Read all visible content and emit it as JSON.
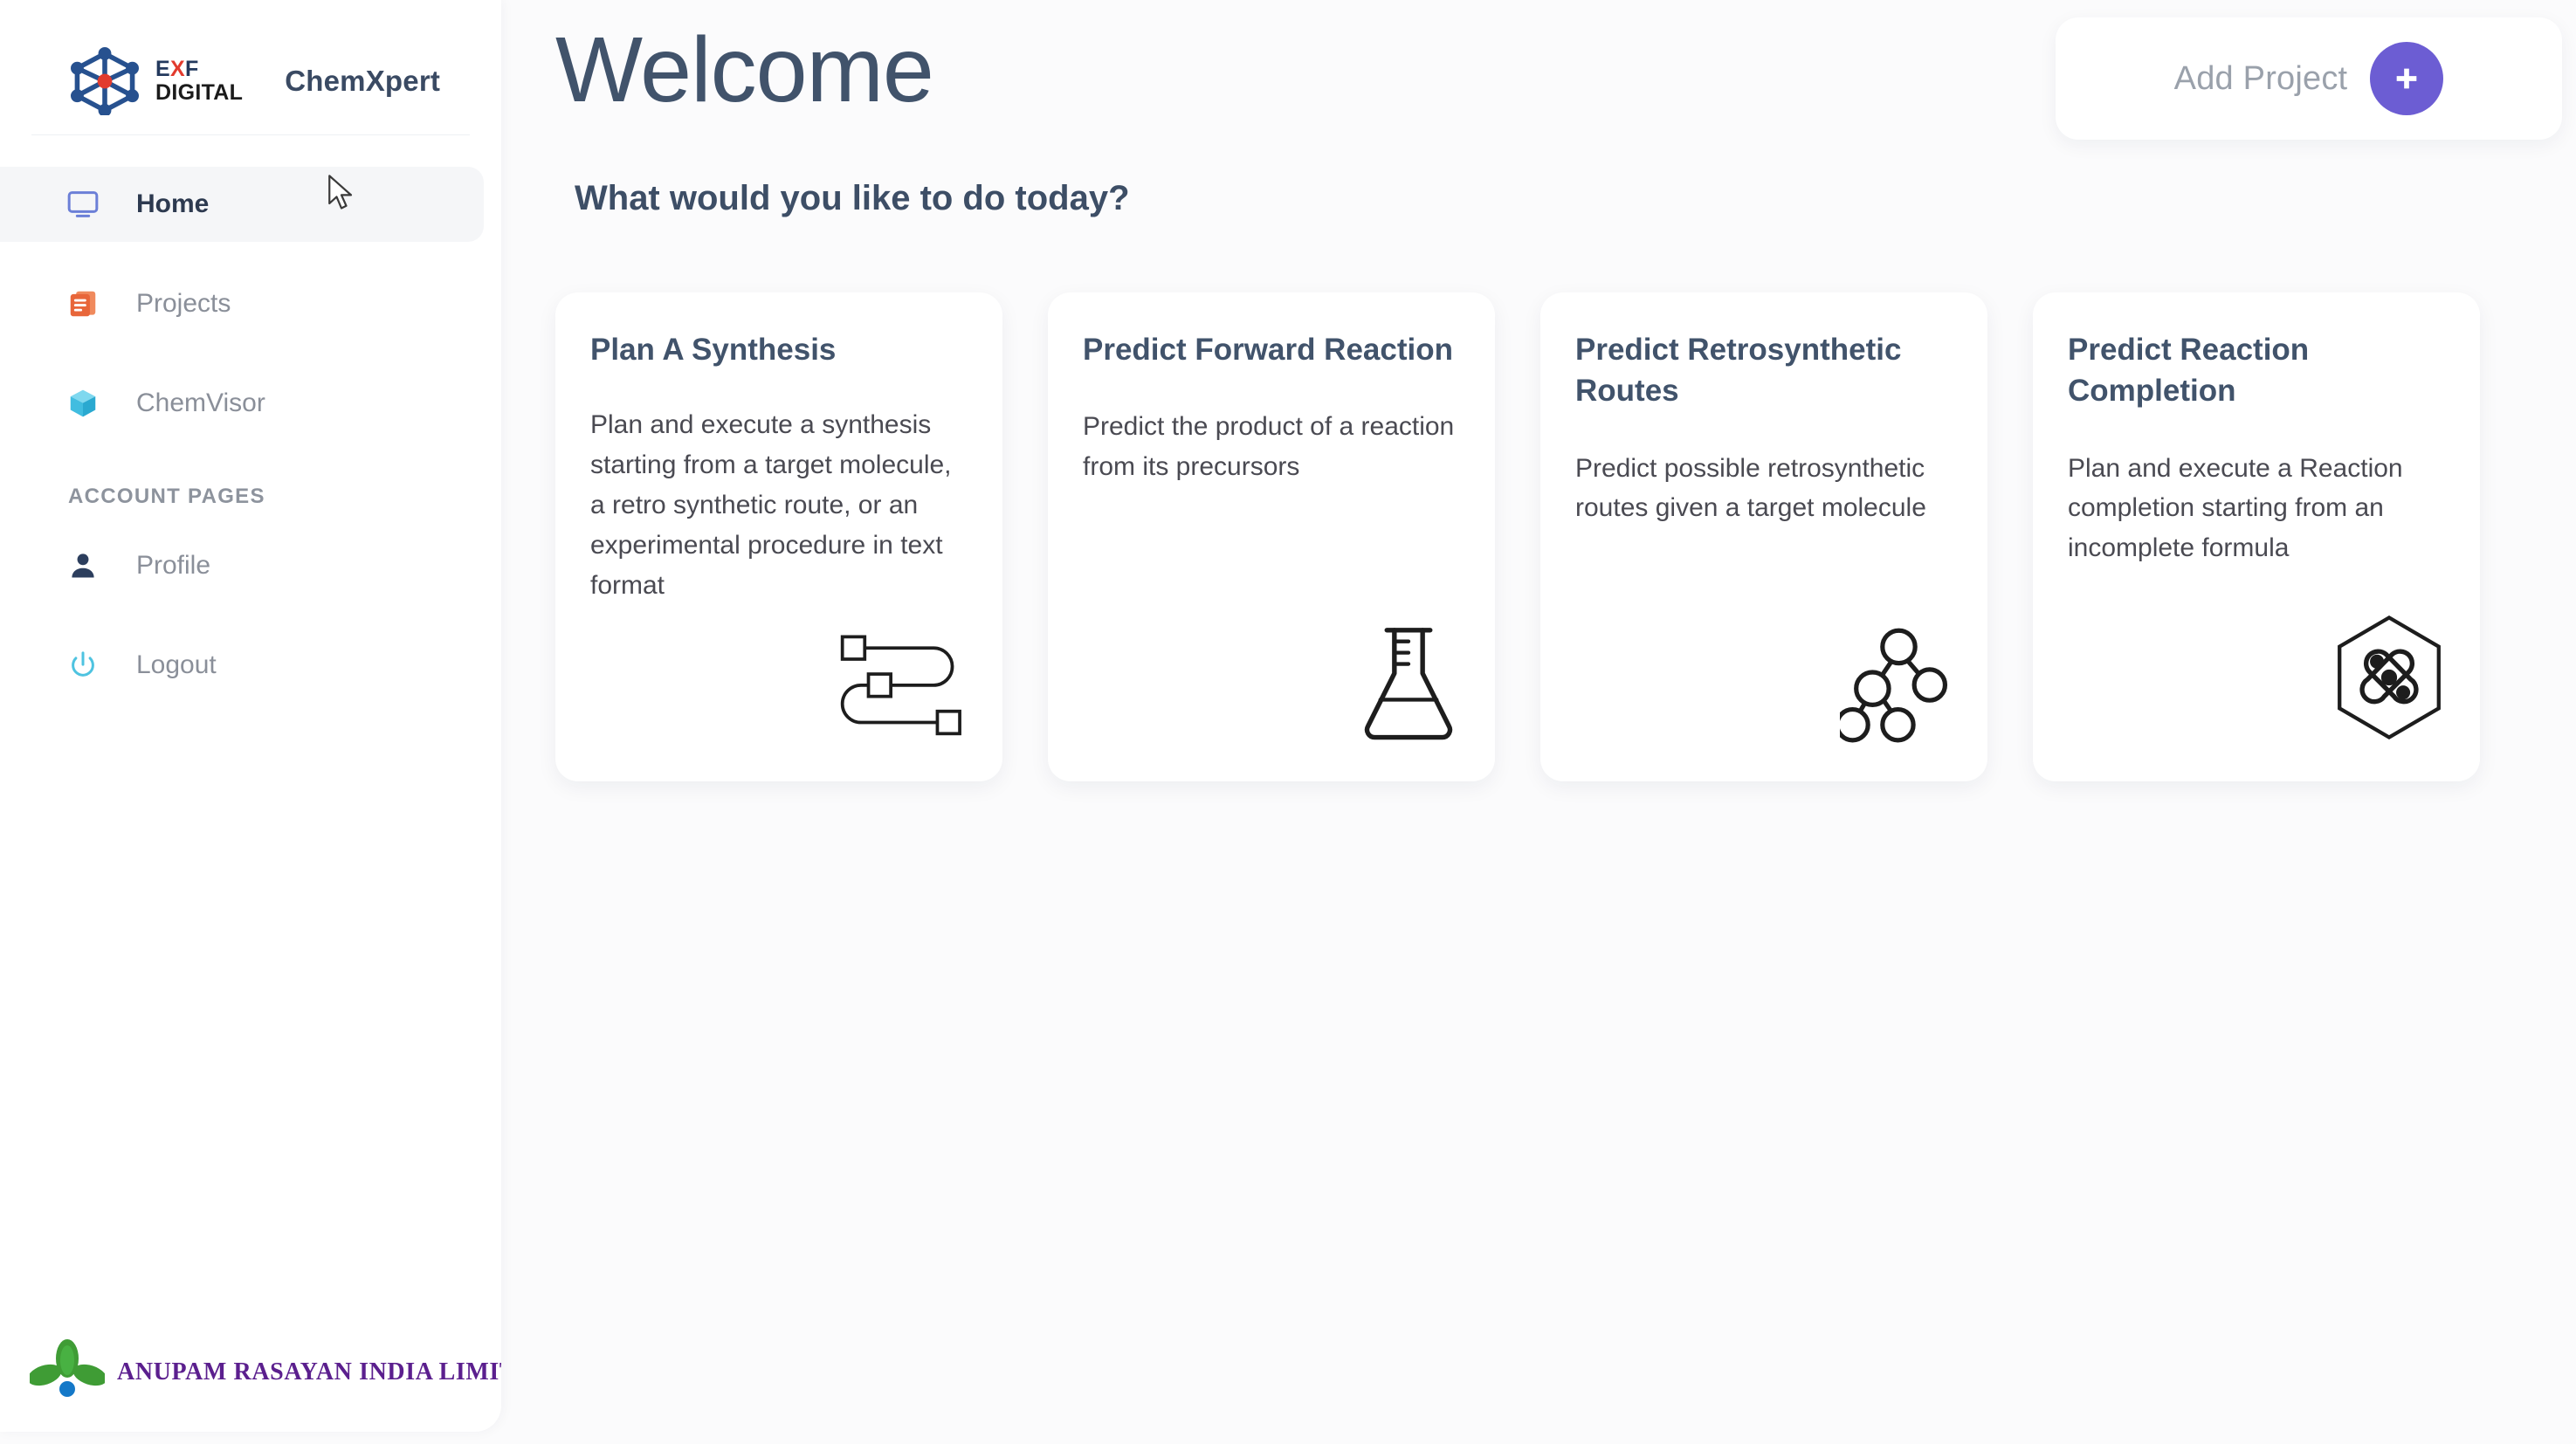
{
  "sidebar": {
    "brand": {
      "logo_icon": "molecular-hexagon-logo-icon",
      "logo_line1_pre": "E",
      "logo_line1_x": "X",
      "logo_line1_post": "F",
      "logo_line2": "DIGITAL",
      "app_name": "ChemXpert"
    },
    "nav_items": [
      {
        "label": "Home",
        "icon": "monitor-icon",
        "active": true
      },
      {
        "label": "Projects",
        "icon": "document-stack-icon",
        "active": false
      },
      {
        "label": "ChemVisor",
        "icon": "cube-icon",
        "active": false
      }
    ],
    "section_title": "ACCOUNT PAGES",
    "account_items": [
      {
        "label": "Profile",
        "icon": "person-icon",
        "active": false
      },
      {
        "label": "Logout",
        "icon": "power-icon",
        "active": false
      }
    ],
    "footer": {
      "icon": "leaves-droplet-icon",
      "company": "ANUPAM RASAYAN INDIA LIMITED"
    }
  },
  "main": {
    "title": "Welcome",
    "subtitle": "What would you like to do today?",
    "add_project": {
      "label": "Add Project",
      "button_icon": "plus-icon"
    },
    "cards": [
      {
        "title": "Plan A Synthesis",
        "description": "Plan and execute a synthesis starting from a target molecule, a retro synthetic route, or an experimental procedure in text format",
        "icon": "route-path-icon"
      },
      {
        "title": "Predict Forward Reaction",
        "description": "Predict the product of a reaction from its precursors",
        "icon": "erlenmeyer-flask-icon"
      },
      {
        "title": "Predict Retrosynthetic Routes",
        "description": "Predict possible retrosynthetic routes given a target molecule",
        "icon": "tree-graph-icon"
      },
      {
        "title": "Predict Reaction Completion",
        "description": "Plan and execute a Reaction completion starting from an incomplete formula",
        "icon": "hexagon-molecule-icon"
      }
    ]
  },
  "colors": {
    "accent_purple": "#6c5dd3",
    "heading": "#41536b",
    "muted_text": "#8a8f99",
    "page_bg": "#fbfbfc",
    "brand_red": "#e23b2e",
    "icon_blue": "#6b7fd7",
    "icon_orange": "#e8663a",
    "icon_cyan": "#4ec3e0",
    "icon_navy": "#2c3e5d",
    "footer_purple": "#5b1f8e"
  }
}
